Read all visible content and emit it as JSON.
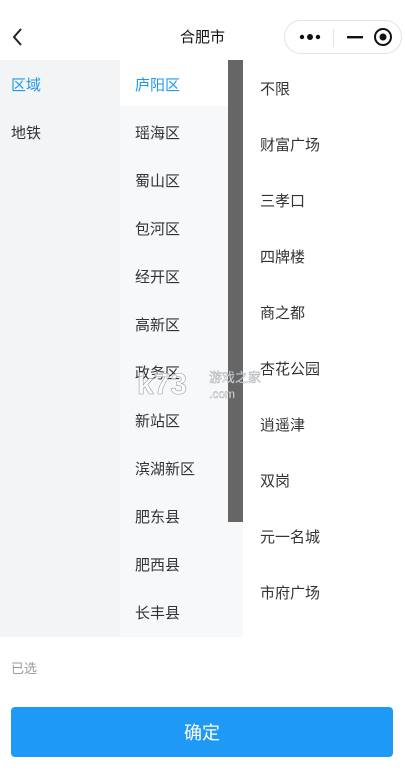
{
  "header": {
    "title": "合肥市"
  },
  "tabs": [
    {
      "label": "区域"
    },
    {
      "label": "地铁"
    }
  ],
  "districts": [
    "庐阳区",
    "瑶海区",
    "蜀山区",
    "包河区",
    "经开区",
    "高新区",
    "政务区",
    "新站区",
    "滨湖新区",
    "肥东县",
    "肥西县",
    "长丰县"
  ],
  "areas": [
    "不限",
    "财富广场",
    "三孝口",
    "四牌楼",
    "商之都",
    "杏花公园",
    "逍遥津",
    "双岗",
    "元一名城",
    "市府广场"
  ],
  "footer": {
    "selected_label": "已选",
    "confirm_label": "确定"
  },
  "watermark": {
    "text": "游戏之家",
    "logo": "k73",
    "suffix": ".com"
  },
  "colors": {
    "accent": "#1e9ae8",
    "button": "#1e9af6",
    "scrollbar": "#666666"
  }
}
